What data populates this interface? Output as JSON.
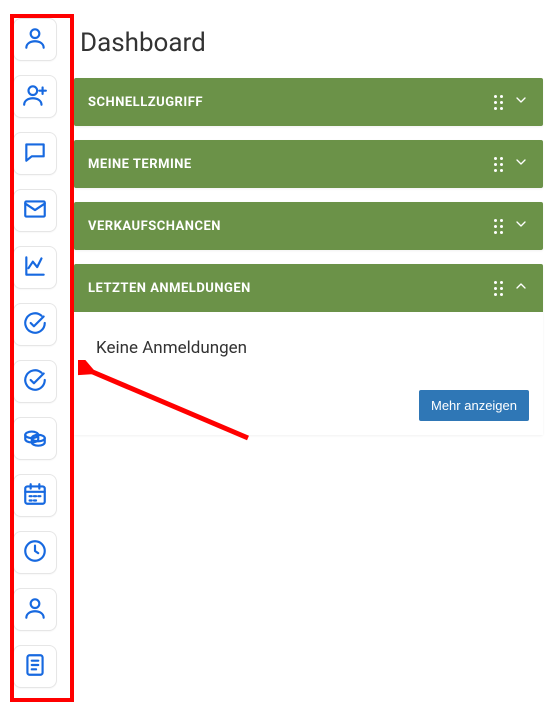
{
  "page": {
    "title": "Dashboard"
  },
  "sidebar": {
    "items": [
      {
        "name": "person-icon"
      },
      {
        "name": "person-plus-icon"
      },
      {
        "name": "chat-bubble-icon"
      },
      {
        "name": "mail-icon"
      },
      {
        "name": "chart-line-icon"
      },
      {
        "name": "check-circle-icon"
      },
      {
        "name": "check-circle-icon-2"
      },
      {
        "name": "coins-icon"
      },
      {
        "name": "calendar-icon"
      },
      {
        "name": "clock-icon"
      },
      {
        "name": "person-icon-2"
      },
      {
        "name": "note-icon"
      }
    ]
  },
  "panels": [
    {
      "title": "SCHNELLZUGRIFF",
      "expanded": false
    },
    {
      "title": "MEINE TERMINE",
      "expanded": false
    },
    {
      "title": "VERKAUFSCHANCEN",
      "expanded": false
    },
    {
      "title": "LETZTEN ANMELDUNGEN",
      "expanded": true,
      "empty_text": "Keine Anmeldungen",
      "more_label": "Mehr anzeigen"
    }
  ],
  "colors": {
    "accent": "#1769e0",
    "panel": "#6b9248",
    "button": "#2f77b6",
    "annotation": "#ff0000"
  }
}
